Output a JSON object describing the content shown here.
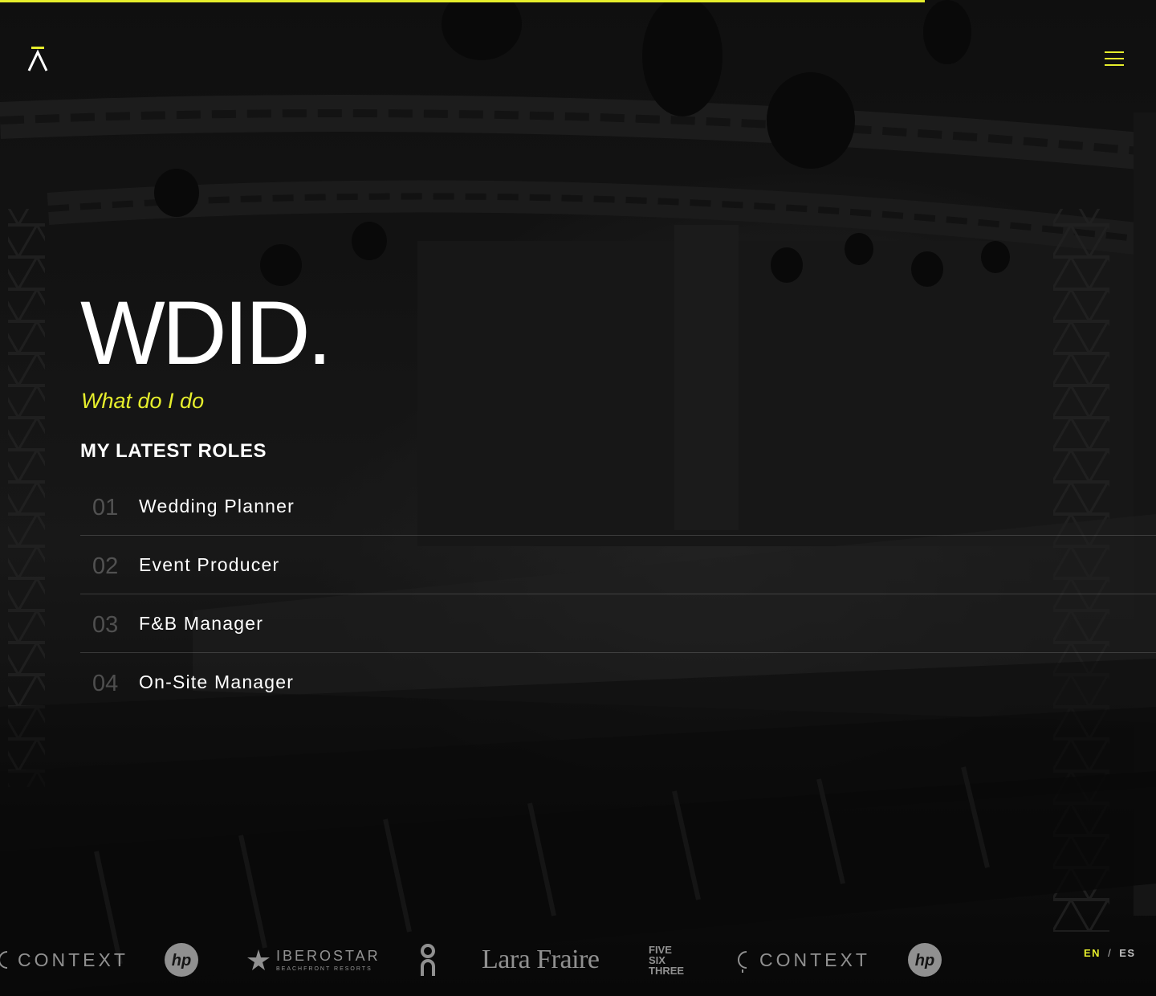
{
  "progress": {
    "value_percent": 80,
    "color": "#e6ee2c"
  },
  "header": {
    "logo_icon": "lambda-logo-icon",
    "menu_icon": "hamburger-menu-icon"
  },
  "hero": {
    "title": "WDID.",
    "subtitle": "What do I do"
  },
  "roles_section": {
    "heading": "MY LATEST ROLES",
    "items": [
      {
        "number": "01",
        "label": "Wedding Planner"
      },
      {
        "number": "02",
        "label": "Event Producer"
      },
      {
        "number": "03",
        "label": "F&B Manager"
      },
      {
        "number": "04",
        "label": "On-Site Manager"
      }
    ]
  },
  "client_logos": {
    "context_1": "CONTEXT",
    "hp_1": "hp",
    "iberostar_name": "IBEROSTAR",
    "iberostar_sub": "BEACHFRONT RESORTS",
    "on_running": "on",
    "lara_fraire": "Lara Fraire",
    "five_six_three": [
      "FIVE",
      "SIX",
      "THREE"
    ],
    "context_2": "CONTEXT",
    "hp_2": "hp"
  },
  "language": {
    "active": "EN",
    "separator": "/",
    "other": "ES"
  },
  "colors": {
    "accent": "#e6ee2c",
    "background": "#151515",
    "text": "#ffffff"
  }
}
